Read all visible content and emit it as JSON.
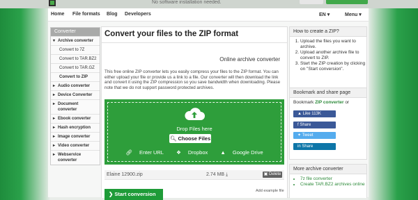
{
  "topbar": {
    "notice": "No software installation needed."
  },
  "nav": {
    "items": [
      "Home",
      "File formats",
      "Blog",
      "Developers"
    ],
    "language": "EN",
    "menu": "Menu"
  },
  "sidebar": {
    "header": "Converter",
    "items": [
      {
        "label": "Archive converter",
        "type": "cat open"
      },
      {
        "label": "Convert to 7Z",
        "type": "sub"
      },
      {
        "label": "Convert to TAR.BZ2",
        "type": "sub"
      },
      {
        "label": "Convert to TAR.GZ",
        "type": "sub"
      },
      {
        "label": "Convert to ZIP",
        "type": "sub act"
      },
      {
        "label": "Audio converter",
        "type": "cat"
      },
      {
        "label": "Device Converter",
        "type": "cat"
      },
      {
        "label": "Document converter",
        "type": "cat"
      },
      {
        "label": "Ebook converter",
        "type": "cat"
      },
      {
        "label": "Hash encryption",
        "type": "cat"
      },
      {
        "label": "Image converter",
        "type": "cat"
      },
      {
        "label": "Video converter",
        "type": "cat"
      },
      {
        "label": "Webservice converter",
        "type": "cat"
      }
    ]
  },
  "main": {
    "title": "Convert your files to the ZIP format",
    "subtitle": "Online archive converter",
    "description": "This free online ZIP converter lets you easily compress your files to the ZIP format. You can either upload your file or provide us a link to a file. Our converter will then download the link and convert it using the ZIP compression so you save bandwidth when downloading. Please note that we do not support password protected archives.",
    "drop_text": "Drop Files here",
    "choose_files": "Choose Files",
    "enter_url": "Enter URL",
    "dropbox": "Dropbox",
    "google_drive": "Google Drive",
    "file": {
      "name": "Elaine 12900.zip",
      "size": "2.74 MB",
      "delete": "Delete"
    },
    "add_example": "Add example file",
    "start": "Start conversion"
  },
  "howto": {
    "title": "How to create a ZIP?",
    "steps": [
      "Upload the files you want to archive.",
      "Upload another archive file to convert to ZIP.",
      "Start the ZIP creation by clicking on \"Start conversion\"."
    ]
  },
  "bookmark": {
    "title": "Bookmark and share page",
    "text_pre": "Bookmark ",
    "text_link": "ZIP converter",
    "text_post": " or",
    "buttons": [
      {
        "label": "Like 113K",
        "color": "#3b5998",
        "icon": "thumbs-up-icon"
      },
      {
        "label": "Share",
        "color": "#3b5998",
        "icon": "facebook-icon"
      },
      {
        "label": "Tweet",
        "color": "#55acee",
        "icon": "twitter-icon"
      },
      {
        "label": "Share",
        "color": "#0e76a8",
        "icon": "linkedin-icon"
      }
    ]
  },
  "more": {
    "title": "More archive converter",
    "items": [
      "7z file converter",
      "Create TAR.BZ2 archives online"
    ]
  },
  "colors": {
    "accent": "#2e9e3b",
    "start": "#1e9b38",
    "link": "#2d8a3a"
  }
}
